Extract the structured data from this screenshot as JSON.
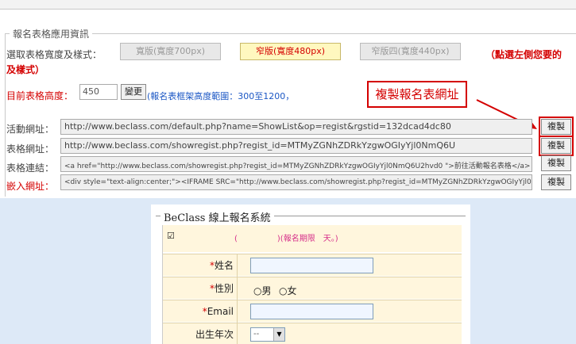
{
  "panel": {
    "legend": "報名表格應用資訊",
    "width_label": "選取表格寬度及樣式：",
    "width_options": [
      "寬版(寬度700px)",
      "窄版(寬度480px)",
      "窄版四(寬度440px)"
    ],
    "width_selected": "窄版(寬度480px)",
    "note_line1": "（點選左側您要的",
    "note_line2": "及樣式）",
    "height_label": "目前表格高度：",
    "height_value": "450",
    "change_button": "變更",
    "height_hint": "(報名表框架高度範圍：300至1200，",
    "callout_text": "複製報名表網址"
  },
  "urls": [
    {
      "label": "活動網址：",
      "value": "http://www.beclass.com/default.php?name=ShowList&op=regist&rgstid=132dcad4dc80",
      "copy": "複製"
    },
    {
      "label": "表格網址：",
      "value": "http://www.beclass.com/showregist.php?regist_id=MTMyZGNhZDRkYzgwOGIyYjl0NmQ6U",
      "copy": "複製"
    },
    {
      "label": "表格連結：",
      "value": "<a href=\"http://www.beclass.com/showregist.php?regist_id=MTMyZGNhZDRkYzgwOGIyYjl0NmQ6U2hvd0             \">前往活動報名表格</a>",
      "copy": "複製"
    },
    {
      "label": "嵌入網址：",
      "value": "<div style=\"text-align:center;\"><IFRAME SRC=\"http://www.beclass.com/showregist.php?regist_id=MTMyZGNhZDRkYzgwOGIyYjl0Nm",
      "copy": "複製"
    }
  ],
  "form": {
    "legend": "BeClass 線上報名系統",
    "checkbox": "☑",
    "banner": "(　　　　　)(報名期限　天。)",
    "fields": {
      "name": "姓名",
      "gender": "性別",
      "male": "男",
      "female": "女",
      "email": "Email",
      "birth_year": "出生年次",
      "birth_select": "--"
    }
  },
  "colors": {
    "accent_red": "#d40000",
    "link_blue": "#1a56c4",
    "form_bg": "#fff6dd",
    "page_bg": "#dde9f7"
  }
}
